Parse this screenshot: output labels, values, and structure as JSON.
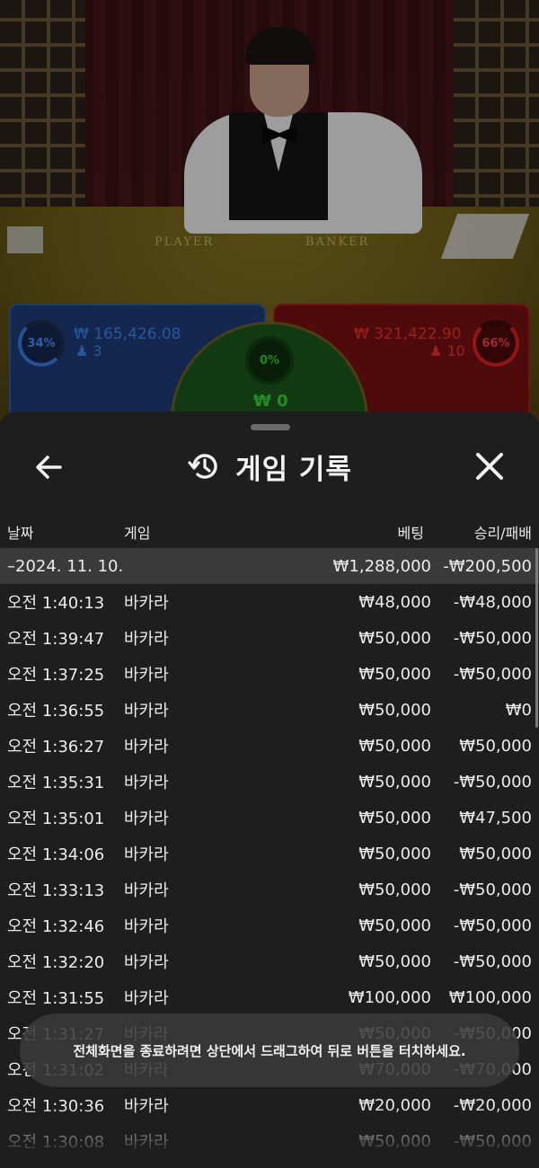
{
  "table": {
    "player_label": "PLAYER",
    "banker_label": "BANKER"
  },
  "bets": {
    "player": {
      "percent": "34%",
      "amount": "₩ 165,426.08",
      "count": "3",
      "color": "#3b86f0"
    },
    "banker": {
      "percent": "66%",
      "amount": "₩ 321,422.90",
      "count": "10",
      "color": "#f03030"
    },
    "tie": {
      "percent": "0%",
      "amount": "₩ 0",
      "color": "#38d838"
    }
  },
  "sheet": {
    "title": "게임 기록",
    "back_icon": "back-arrow-icon",
    "history_icon": "history-icon",
    "close_icon": "close-icon",
    "columns": {
      "date": "날짜",
      "game": "게임",
      "bet": "베팅",
      "result": "승리/패배"
    },
    "date_group": {
      "label": "–2024. 11. 10.",
      "bet_total": "₩1,288,000",
      "result_total": "-₩200,500"
    },
    "rows": [
      {
        "time": "오전 1:40:13",
        "game": "바카라",
        "bet": "₩48,000",
        "result": "-₩48,000"
      },
      {
        "time": "오전 1:39:47",
        "game": "바카라",
        "bet": "₩50,000",
        "result": "-₩50,000"
      },
      {
        "time": "오전 1:37:25",
        "game": "바카라",
        "bet": "₩50,000",
        "result": "-₩50,000"
      },
      {
        "time": "오전 1:36:55",
        "game": "바카라",
        "bet": "₩50,000",
        "result": "₩0"
      },
      {
        "time": "오전 1:36:27",
        "game": "바카라",
        "bet": "₩50,000",
        "result": "₩50,000"
      },
      {
        "time": "오전 1:35:31",
        "game": "바카라",
        "bet": "₩50,000",
        "result": "-₩50,000"
      },
      {
        "time": "오전 1:35:01",
        "game": "바카라",
        "bet": "₩50,000",
        "result": "₩47,500"
      },
      {
        "time": "오전 1:34:06",
        "game": "바카라",
        "bet": "₩50,000",
        "result": "₩50,000"
      },
      {
        "time": "오전 1:33:13",
        "game": "바카라",
        "bet": "₩50,000",
        "result": "-₩50,000"
      },
      {
        "time": "오전 1:32:46",
        "game": "바카라",
        "bet": "₩50,000",
        "result": "-₩50,000"
      },
      {
        "time": "오전 1:32:20",
        "game": "바카라",
        "bet": "₩50,000",
        "result": "-₩50,000"
      },
      {
        "time": "오전 1:31:55",
        "game": "바카라",
        "bet": "₩100,000",
        "result": "₩100,000"
      },
      {
        "time": "오전 1:31:27",
        "game": "바카라",
        "bet": "₩50,000",
        "result": "-₩50,000"
      },
      {
        "time": "오전 1:31:02",
        "game": "바카라",
        "bet": "₩70,000",
        "result": "-₩70,000"
      },
      {
        "time": "오전 1:30:36",
        "game": "바카라",
        "bet": "₩20,000",
        "result": "-₩20,000"
      },
      {
        "time": "오전 1:30:08",
        "game": "바카라",
        "bet": "₩50,000",
        "result": "-₩50,000"
      }
    ]
  },
  "toast": {
    "message": "전체화면을 종료하려면 상단에서 드래그하여 뒤로 버튼을 터치하세요."
  }
}
